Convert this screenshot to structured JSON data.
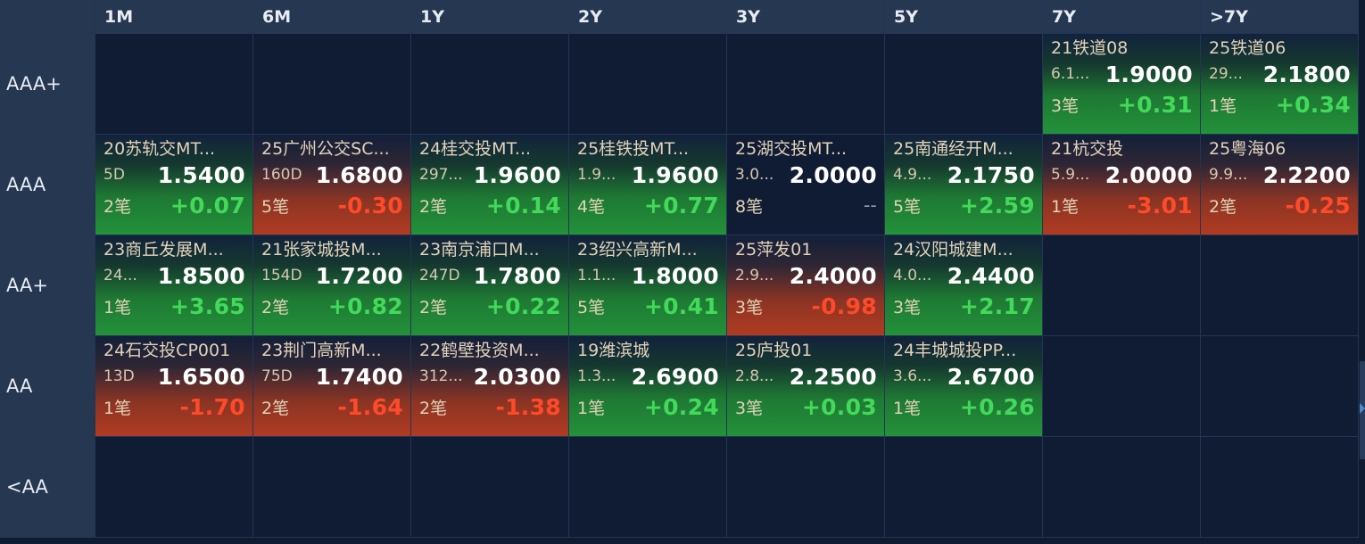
{
  "columns": [
    "1M",
    "6M",
    "1Y",
    "2Y",
    "3Y",
    "5Y",
    "7Y",
    ">7Y"
  ],
  "rows": [
    {
      "label": "AAA+",
      "cells": [
        null,
        null,
        null,
        null,
        null,
        null,
        {
          "name": "21铁道08",
          "term": "6.1...",
          "rate": "1.9000",
          "count": "3笔",
          "change": "+0.31",
          "trend": "up"
        },
        {
          "name": "25铁道06",
          "term": "29...",
          "rate": "2.1800",
          "count": "1笔",
          "change": "+0.34",
          "trend": "up"
        }
      ]
    },
    {
      "label": "AAA",
      "cells": [
        {
          "name": "20苏轨交MT...",
          "term": "5D",
          "rate": "1.5400",
          "count": "2笔",
          "change": "+0.07",
          "trend": "up"
        },
        {
          "name": "25广州公交SC...",
          "term": "160D",
          "rate": "1.6800",
          "count": "5笔",
          "change": "-0.30",
          "trend": "down"
        },
        {
          "name": "24桂交投MT...",
          "term": "297...",
          "rate": "1.9600",
          "count": "2笔",
          "change": "+0.14",
          "trend": "up"
        },
        {
          "name": "25桂铁投MT...",
          "term": "1.9...",
          "rate": "1.9600",
          "count": "4笔",
          "change": "+0.77",
          "trend": "up"
        },
        {
          "name": "25湖交投MT...",
          "term": "3.0...",
          "rate": "2.0000",
          "count": "8笔",
          "change": "--",
          "trend": "flat"
        },
        {
          "name": "25南通经开M...",
          "term": "4.9...",
          "rate": "2.1750",
          "count": "5笔",
          "change": "+2.59",
          "trend": "up"
        },
        {
          "name": "21杭交投",
          "term": "5.9...",
          "rate": "2.0000",
          "count": "1笔",
          "change": "-3.01",
          "trend": "down"
        },
        {
          "name": "25粤海06",
          "term": "9.9...",
          "rate": "2.2200",
          "count": "2笔",
          "change": "-0.25",
          "trend": "down"
        }
      ]
    },
    {
      "label": "AA+",
      "cells": [
        {
          "name": "23商丘发展M...",
          "term": "24...",
          "rate": "1.8500",
          "count": "1笔",
          "change": "+3.65",
          "trend": "up"
        },
        {
          "name": "21张家城投M...",
          "term": "154D",
          "rate": "1.7200",
          "count": "2笔",
          "change": "+0.82",
          "trend": "up"
        },
        {
          "name": "23南京浦口M...",
          "term": "247D",
          "rate": "1.7800",
          "count": "2笔",
          "change": "+0.22",
          "trend": "up"
        },
        {
          "name": "23绍兴高新M...",
          "term": "1.1...",
          "rate": "1.8000",
          "count": "5笔",
          "change": "+0.41",
          "trend": "up"
        },
        {
          "name": "25萍发01",
          "term": "2.9...",
          "rate": "2.4000",
          "count": "3笔",
          "change": "-0.98",
          "trend": "down"
        },
        {
          "name": "24汉阳城建M...",
          "term": "4.0...",
          "rate": "2.4400",
          "count": "3笔",
          "change": "+2.17",
          "trend": "up"
        },
        null,
        null
      ]
    },
    {
      "label": "AA",
      "cells": [
        {
          "name": "24石交投CP001",
          "term": "13D",
          "rate": "1.6500",
          "count": "1笔",
          "change": "-1.70",
          "trend": "down"
        },
        {
          "name": "23荆门高新M...",
          "term": "75D",
          "rate": "1.7400",
          "count": "2笔",
          "change": "-1.64",
          "trend": "down"
        },
        {
          "name": "22鹤壁投资M...",
          "term": "312...",
          "rate": "2.0300",
          "count": "2笔",
          "change": "-1.38",
          "trend": "down"
        },
        {
          "name": "19潍滨城",
          "term": "1.3...",
          "rate": "2.6900",
          "count": "1笔",
          "change": "+0.24",
          "trend": "up"
        },
        {
          "name": "25庐投01",
          "term": "2.8...",
          "rate": "2.2500",
          "count": "3笔",
          "change": "+0.03",
          "trend": "up"
        },
        {
          "name": "24丰城城投PP...",
          "term": "3.6...",
          "rate": "2.6700",
          "count": "1笔",
          "change": "+0.26",
          "trend": "up"
        },
        null,
        null
      ]
    },
    {
      "label": "<AA",
      "cells": [
        null,
        null,
        null,
        null,
        null,
        null,
        null,
        null
      ]
    }
  ],
  "colors": {
    "background": "#0f1b30",
    "header": "#263752",
    "positive": "#43d95a",
    "negative": "#ff4a2a",
    "name_text": "#e2d2b8"
  }
}
